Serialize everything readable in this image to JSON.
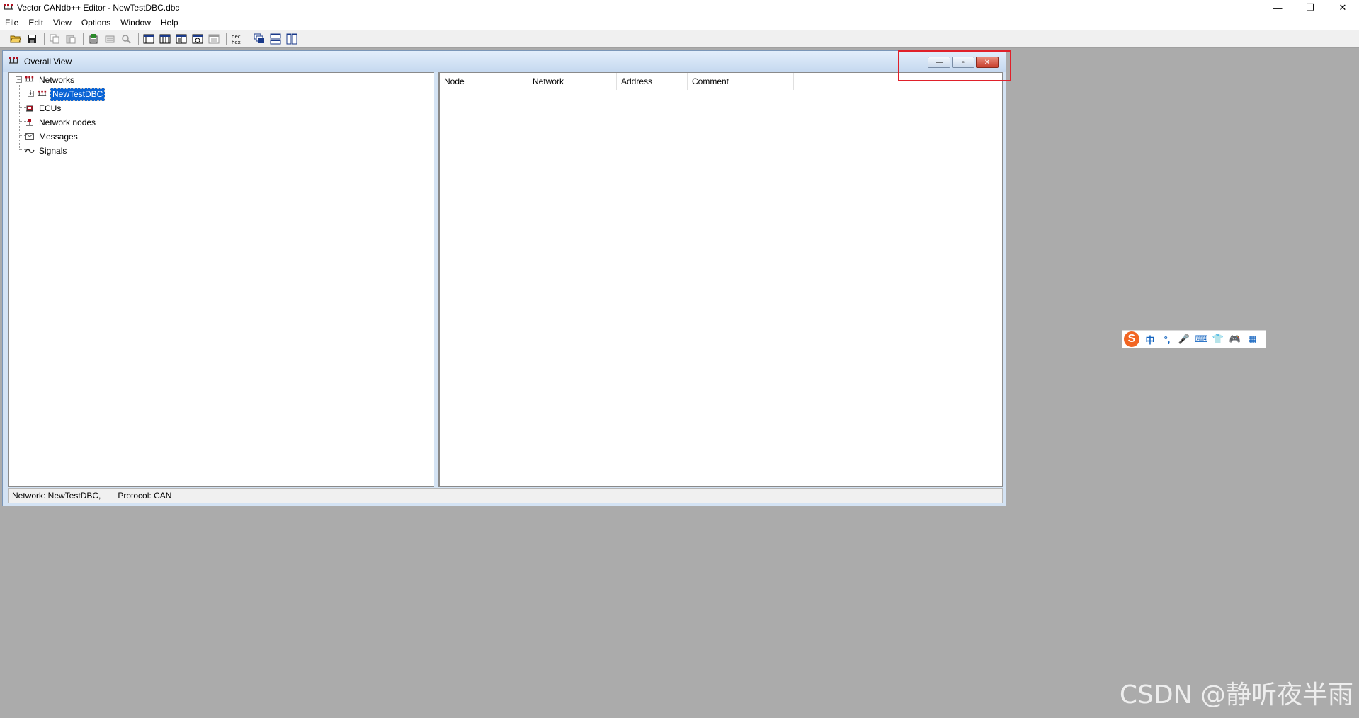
{
  "app": {
    "title": "Vector CANdb++ Editor - NewTestDBC.dbc",
    "window_controls": {
      "minimize": "—",
      "restore": "❐",
      "close": "✕"
    }
  },
  "menu": [
    "File",
    "Edit",
    "View",
    "Options",
    "Window",
    "Help"
  ],
  "toolbar": {
    "icons": [
      "open-icon",
      "save-icon",
      "copy-icon",
      "paste-icon",
      "add-icon",
      "properties-icon",
      "find-icon",
      "view1-icon",
      "view2-icon",
      "view3-icon",
      "view4-icon",
      "view5-icon",
      "dec-hex-icon",
      "cascade-icon",
      "tile-horizontal-icon",
      "tile-vertical-icon"
    ],
    "dec_hex_label": "dec hex"
  },
  "child_window": {
    "title": "Overall View",
    "controls": {
      "minimize": "—",
      "restore": "▫",
      "close": "✕"
    },
    "highlight_color": "#e0202a"
  },
  "tree": {
    "networks": "Networks",
    "network_item": "NewTestDBC",
    "ecus": "ECUs",
    "network_nodes": "Network nodes",
    "messages": "Messages",
    "signals": "Signals"
  },
  "list": {
    "columns": [
      "Node",
      "Network",
      "Address",
      "Comment"
    ],
    "rows": []
  },
  "status": {
    "network": "Network: NewTestDBC,",
    "protocol": "Protocol: CAN"
  },
  "ime": {
    "logo": "S",
    "items": [
      "中",
      "°,",
      "🎤",
      "⌨",
      "👕",
      "🎮",
      "▦"
    ]
  },
  "watermark": "CSDN @静听夜半雨"
}
